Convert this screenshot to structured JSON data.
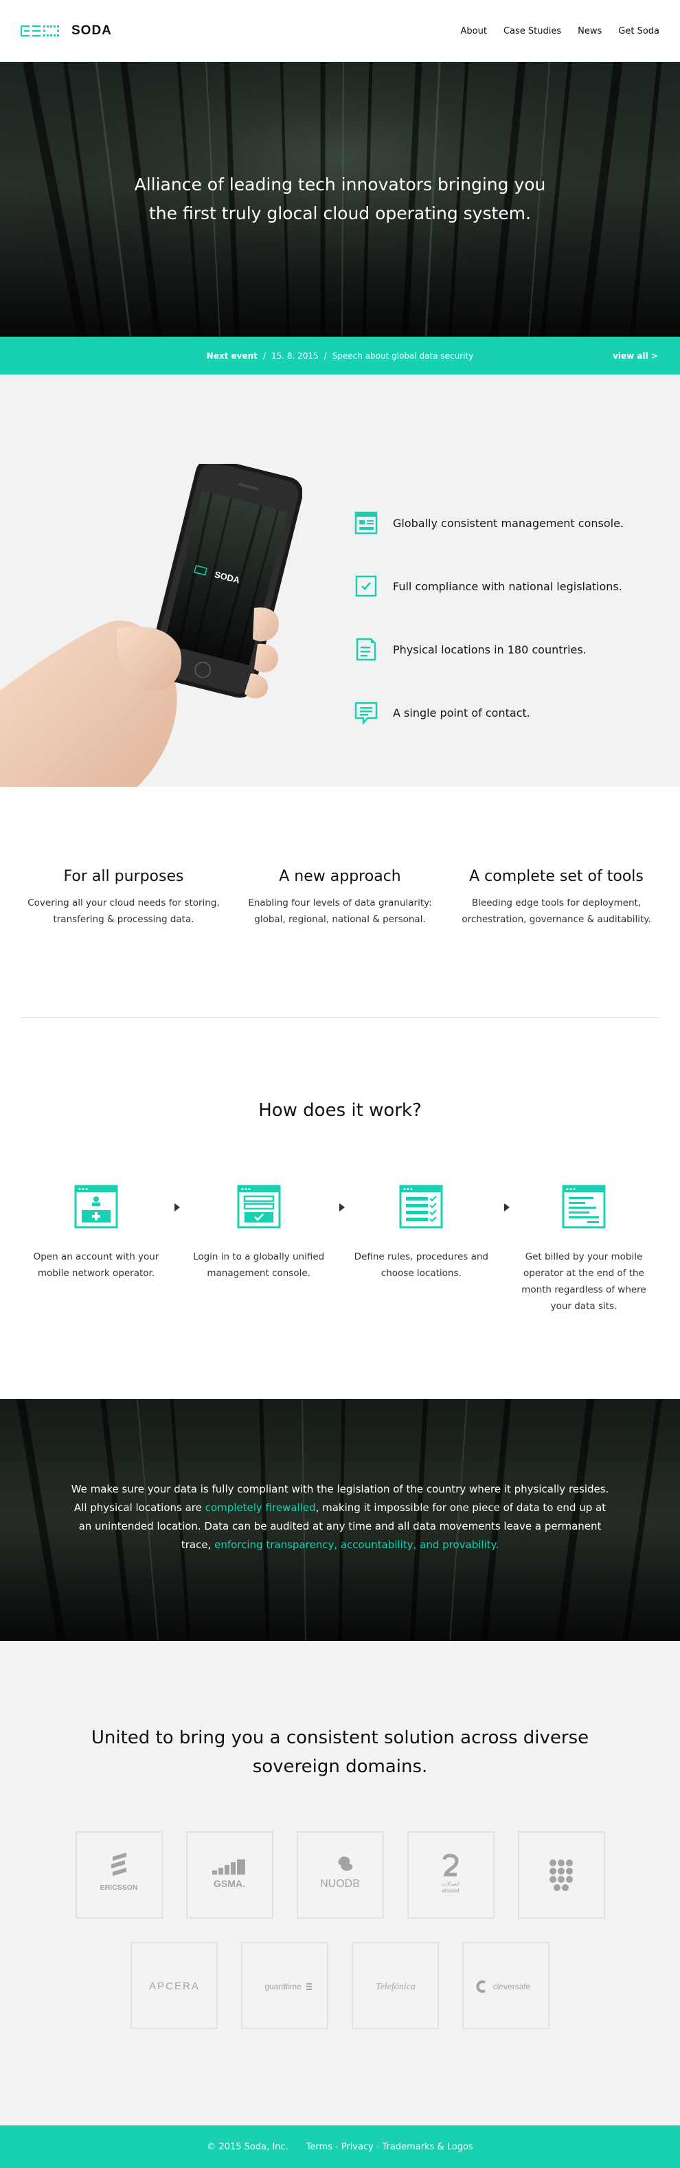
{
  "header": {
    "brand_name": "SODA",
    "nav": [
      {
        "label": "About"
      },
      {
        "label": "Case Studies"
      },
      {
        "label": "News"
      },
      {
        "label": "Get Soda"
      }
    ]
  },
  "hero": {
    "line1": "Alliance of leading tech innovators bringing you",
    "line2": "the first truly glocal cloud operating system."
  },
  "event": {
    "label": "Next event",
    "date": "15. 8. 2015",
    "title": "Speech about global data security",
    "view_all": "view all >"
  },
  "phone": {
    "screen_brand": "SODA"
  },
  "features": [
    {
      "text": "Globally consistent management console.",
      "icon": "console-icon"
    },
    {
      "text": "Full compliance with national legislations.",
      "icon": "check-icon"
    },
    {
      "text": "Physical locations in 180 countries.",
      "icon": "document-icon"
    },
    {
      "text": "A single point of contact.",
      "icon": "chat-icon"
    }
  ],
  "purposes": [
    {
      "title": "For all purposes",
      "line1": "Covering all your cloud needs for storing,",
      "line2": "transfering & processing data."
    },
    {
      "title": "A new approach",
      "line1": "Enabling four levels of data granularity:",
      "line2": "global, regional, national & personal."
    },
    {
      "title": "A complete set of tools",
      "line1": "Bleeding edge tools for deployment,",
      "line2": "orchestration, governance & auditability."
    }
  ],
  "how": {
    "title": "How does it work?",
    "steps": [
      {
        "lines": [
          "Open an account with your",
          "mobile network operator."
        ]
      },
      {
        "lines": [
          "Login in to a globally unified",
          "management console."
        ]
      },
      {
        "lines": [
          "Define rules, procedures and",
          "choose locations."
        ]
      },
      {
        "lines": [
          "Get billed by your mobile",
          "operator at the end of the",
          "month regardless of where",
          "your data sits."
        ]
      }
    ]
  },
  "compliance": {
    "t1": "We make sure your data is fully compliant with the legislation of the country where it physically resides. All physical locations are ",
    "h1": "completely firewalled",
    "t2": ", making it impossible for one piece of data to end up at an unintended location. Data can be audited at any time and all data movements leave a permanent trace, ",
    "h2": "enforcing transparency, accountability, and provability."
  },
  "partners": {
    "title_line1": "United to bring you a consistent solution across diverse",
    "title_line2": "sovereign domains.",
    "logos_row1": [
      "ERICSSON",
      "GSMA.",
      "NUODB",
      "etisalat",
      ""
    ],
    "logos_row2": [
      "APCERA",
      "guardtime",
      "Telefónica",
      "cleversafe"
    ]
  },
  "footer": {
    "copyright": "© 2015 Soda, Inc.",
    "terms": "Terms",
    "privacy": "Privacy",
    "trademarks": "Trademarks & Logos"
  },
  "colors": {
    "accent": "#19d1b1",
    "dark": "#0c0f0d",
    "light": "#f2f2f2"
  }
}
